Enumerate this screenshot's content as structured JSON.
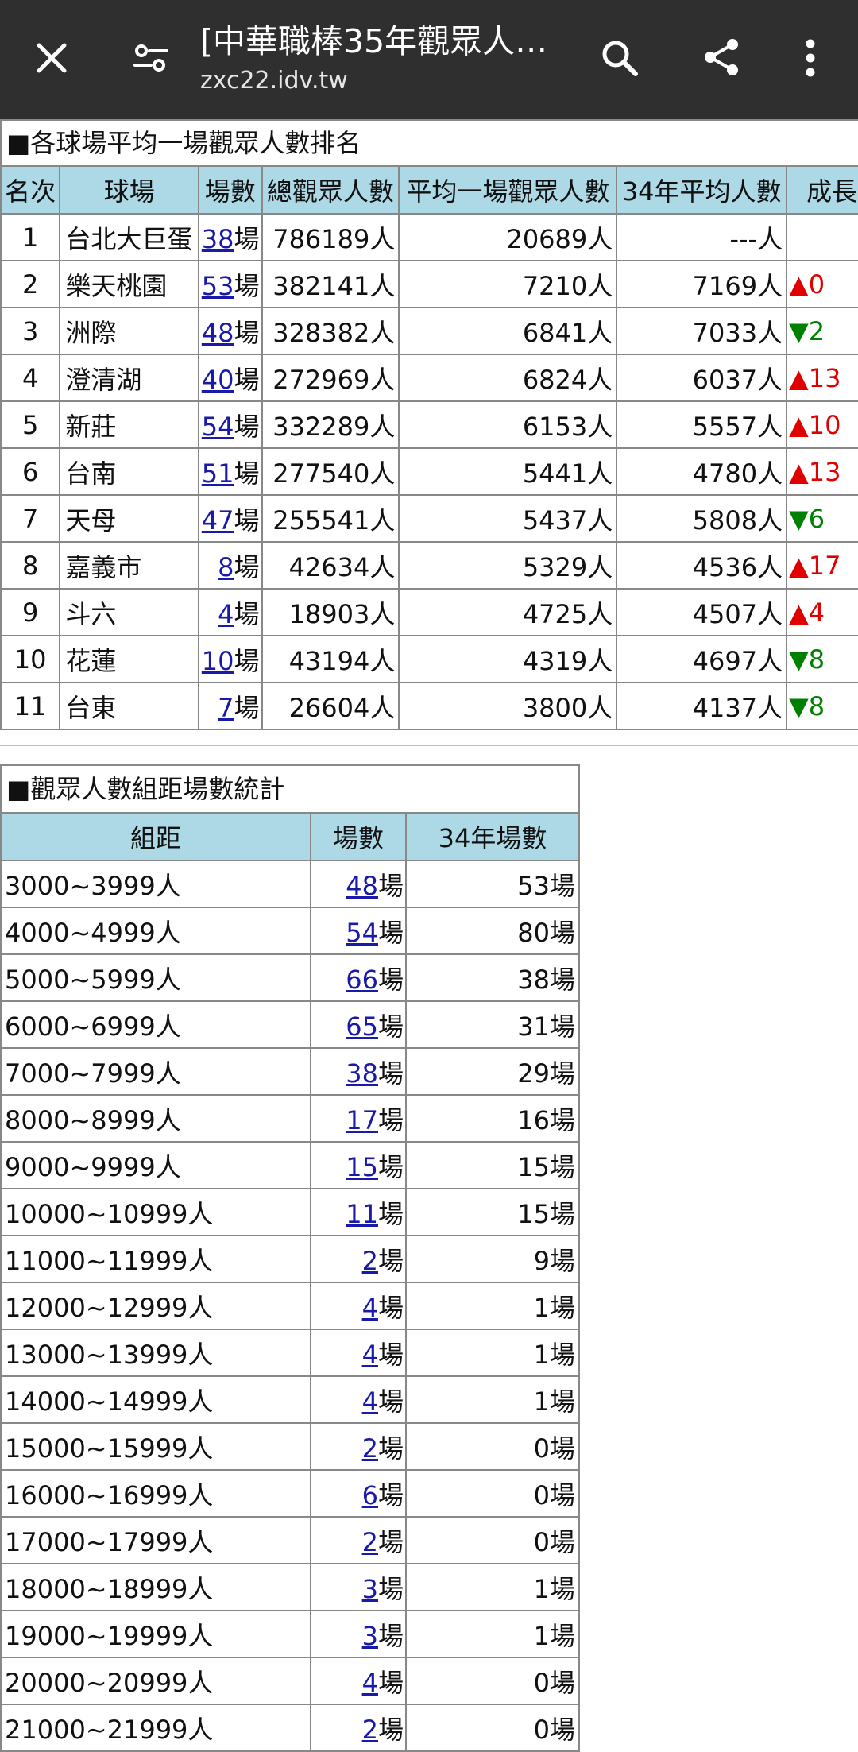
{
  "browser": {
    "title": "[中華職棒35年觀眾人數...",
    "url": "zxc22.idv.tw"
  },
  "icons": {
    "close": "close-icon",
    "tune": "tune-icon",
    "search": "search-icon",
    "share": "share-icon",
    "more": "more-vert-icon"
  },
  "colors": {
    "header_bg": "#add8e6",
    "up": "#e00000",
    "down": "#008000",
    "link": "#1a1aaa"
  },
  "ranking": {
    "caption": "■各球場平均一場觀眾人數排名",
    "headers": [
      "名次",
      "球場",
      "場數",
      "總觀眾人數",
      "平均一場觀眾人數",
      "34年平均人數",
      "成長"
    ],
    "games_suffix": "場",
    "rows": [
      {
        "rank": "1",
        "stadium": "台北大巨蛋",
        "games": "38",
        "total": "786189人",
        "avg": "20689人",
        "avg34": "---人",
        "growth": ""
      },
      {
        "rank": "2",
        "stadium": "樂天桃園",
        "games": "53",
        "total": "382141人",
        "avg": "7210人",
        "avg34": "7169人",
        "growth": "▲0"
      },
      {
        "rank": "3",
        "stadium": "洲際",
        "games": "48",
        "total": "328382人",
        "avg": "6841人",
        "avg34": "7033人",
        "growth": "▼2"
      },
      {
        "rank": "4",
        "stadium": "澄清湖",
        "games": "40",
        "total": "272969人",
        "avg": "6824人",
        "avg34": "6037人",
        "growth": "▲13"
      },
      {
        "rank": "5",
        "stadium": "新莊",
        "games": "54",
        "total": "332289人",
        "avg": "6153人",
        "avg34": "5557人",
        "growth": "▲10"
      },
      {
        "rank": "6",
        "stadium": "台南",
        "games": "51",
        "total": "277540人",
        "avg": "5441人",
        "avg34": "4780人",
        "growth": "▲13"
      },
      {
        "rank": "7",
        "stadium": "天母",
        "games": "47",
        "total": "255541人",
        "avg": "5437人",
        "avg34": "5808人",
        "growth": "▼6"
      },
      {
        "rank": "8",
        "stadium": "嘉義市",
        "games": "8",
        "total": "42634人",
        "avg": "5329人",
        "avg34": "4536人",
        "growth": "▲17"
      },
      {
        "rank": "9",
        "stadium": "斗六",
        "games": "4",
        "total": "18903人",
        "avg": "4725人",
        "avg34": "4507人",
        "growth": "▲4"
      },
      {
        "rank": "10",
        "stadium": "花蓮",
        "games": "10",
        "total": "43194人",
        "avg": "4319人",
        "avg34": "4697人",
        "growth": "▼8"
      },
      {
        "rank": "11",
        "stadium": "台東",
        "games": "7",
        "total": "26604人",
        "avg": "3800人",
        "avg34": "4137人",
        "growth": "▼8"
      }
    ]
  },
  "distribution": {
    "caption": "■觀眾人數組距場數統計",
    "headers": [
      "組距",
      "場數",
      "34年場數"
    ],
    "games_suffix": "場",
    "rows": [
      {
        "range": "3000~3999人",
        "games": "48",
        "games34": "53場"
      },
      {
        "range": "4000~4999人",
        "games": "54",
        "games34": "80場"
      },
      {
        "range": "5000~5999人",
        "games": "66",
        "games34": "38場"
      },
      {
        "range": "6000~6999人",
        "games": "65",
        "games34": "31場"
      },
      {
        "range": "7000~7999人",
        "games": "38",
        "games34": "29場"
      },
      {
        "range": "8000~8999人",
        "games": "17",
        "games34": "16場"
      },
      {
        "range": "9000~9999人",
        "games": "15",
        "games34": "15場"
      },
      {
        "range": "10000~10999人",
        "games": "11",
        "games34": "15場"
      },
      {
        "range": "11000~11999人",
        "games": "2",
        "games34": "9場"
      },
      {
        "range": "12000~12999人",
        "games": "4",
        "games34": "1場"
      },
      {
        "range": "13000~13999人",
        "games": "4",
        "games34": "1場"
      },
      {
        "range": "14000~14999人",
        "games": "4",
        "games34": "1場"
      },
      {
        "range": "15000~15999人",
        "games": "2",
        "games34": "0場"
      },
      {
        "range": "16000~16999人",
        "games": "6",
        "games34": "0場"
      },
      {
        "range": "17000~17999人",
        "games": "2",
        "games34": "0場"
      },
      {
        "range": "18000~18999人",
        "games": "3",
        "games34": "1場"
      },
      {
        "range": "19000~19999人",
        "games": "3",
        "games34": "1場"
      },
      {
        "range": "20000~20999人",
        "games": "4",
        "games34": "0場"
      },
      {
        "range": "21000~21999人",
        "games": "2",
        "games34": "0場"
      }
    ]
  }
}
